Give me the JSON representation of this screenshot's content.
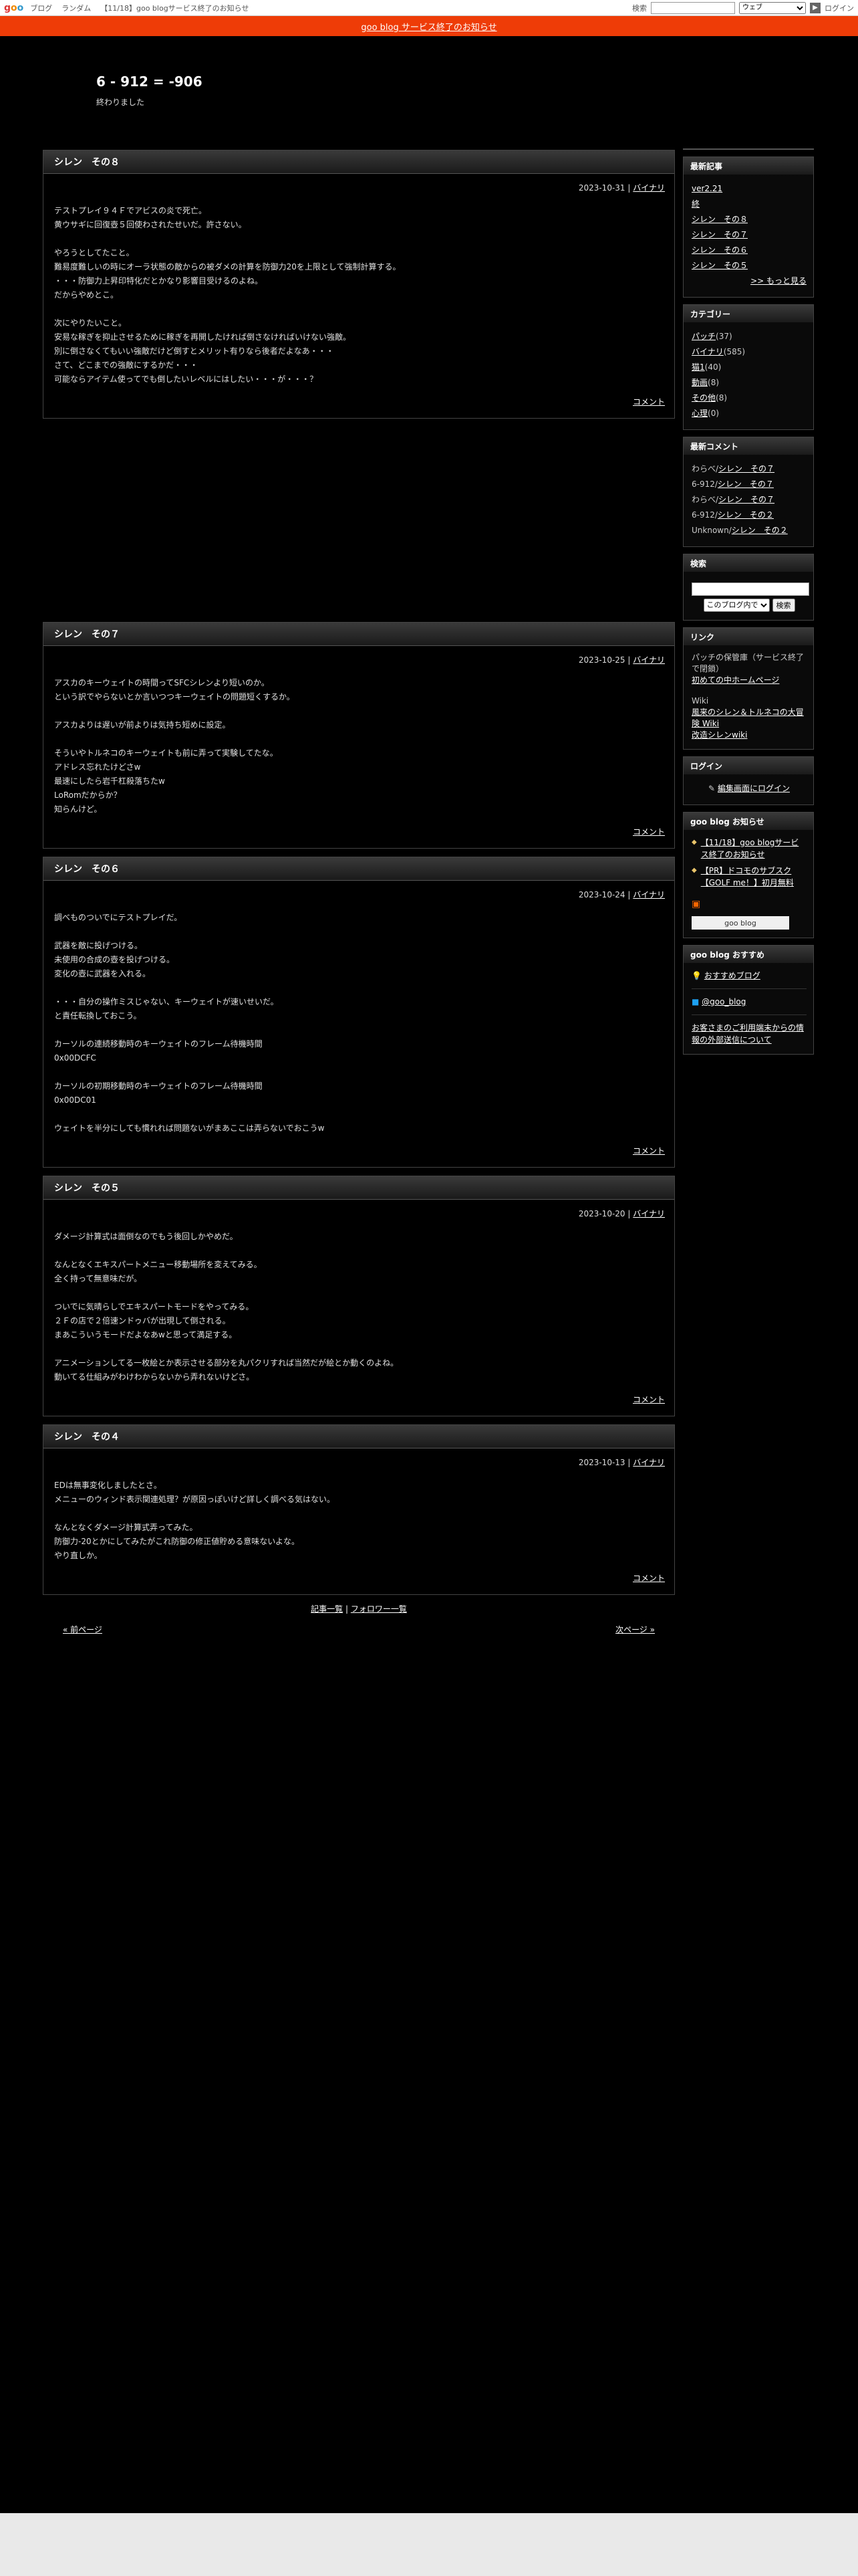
{
  "topbar": {
    "logo": "goo",
    "links": [
      "ブログ",
      "ランダム"
    ],
    "notice": "【11/18】goo blogサービス終了のお知らせ",
    "search_label": "検索",
    "search_select": "ウェブ",
    "login": "ログイン"
  },
  "notice_bar": "goo blog サービス終了のお知らせ",
  "blog": {
    "title": "6 - 912 = -906",
    "description": "終わりました"
  },
  "entries": [
    {
      "title": "シレン　その８",
      "date": "2023-10-31",
      "category": "バイナリ",
      "lines": [
        "テストプレイ９４Ｆでアビスの炎で死亡。",
        "黄ウサギに回復壺５回使わされたせいだ。許さない。",
        "",
        "やろうとしてたこと。",
        "難易度難しいの時にオーラ状態の敵からの被ダメの計算を防御力20を上限として強制計算する。",
        "・・・防御力上昇印特化だとかなり影響目受けるのよね。",
        "だからやめとこ。",
        "",
        "次にやりたいこと。",
        "安易な稼ぎを抑止させるために稼ぎを再開したければ倒さなければいけない強敵。",
        "別に倒さなくてもいい強敵だけど倒すとメリット有りなら後者だよなあ・・・",
        "さて、どこまでの強敵にするかだ・・・",
        "可能ならアイテム使ってでも倒したいレベルにはしたい・・・が・・・？"
      ],
      "footer": "コメント"
    },
    {
      "title": "シレン　その７",
      "date": "2023-10-25",
      "category": "バイナリ",
      "lines": [
        "アスカのキーウェイトの時間ってSFCシレンより短いのか。",
        "という訳でやらないとか言いつつキーウェイトの問題短くするか。",
        "",
        "アスカよりは遅いが前よりは気持ち短めに設定。",
        "",
        "そういやトルネコのキーウェイトも前に弄って実験してたな。",
        "アドレス忘れたけどさw",
        "最速にしたら岩千杠殺落ちたw",
        "LoRomだからか？",
        "知らんけど。"
      ],
      "footer": "コメント"
    },
    {
      "title": "シレン　その６",
      "date": "2023-10-24",
      "category": "バイナリ",
      "lines": [
        "調べものついでにテストプレイだ。",
        "",
        "武器を敵に投げつける。",
        "未使用の合成の壺を投げつける。",
        "変化の壺に武器を入れる。",
        "",
        "・・・自分の操作ミスじゃない、キーウェイトが速いせいだ。",
        "と責任転換しておこう。",
        "",
        "カーソルの連続移動時のキーウェイトのフレーム待機時間",
        "0x00DCFC",
        "",
        "カーソルの初期移動時のキーウェイトのフレーム待機時間",
        "0x00DC01",
        "",
        "ウェイトを半分にしても慣れれば問題ないがまあここは弄らないでおこうw"
      ],
      "footer": "コメント"
    },
    {
      "title": "シレン　その５",
      "date": "2023-10-20",
      "category": "バイナリ",
      "lines": [
        "ダメージ計算式は面倒なのでもう後回しかやめだ。",
        "",
        "なんとなくエキスパートメニュー移動場所を変えてみる。",
        "全く持って無意味だが。",
        "",
        "ついでに気晴らしでエキスパートモードをやってみる。",
        "２Ｆの店で２倍速ンドゥバが出現して倒される。",
        "まあこういうモードだよなあwと思って満足する。",
        "",
        "アニメーションしてる一枚絵とか表示させる部分を丸パクリすれば当然だが絵とか動くのよね。",
        "動いてる仕組みがわけわからないから弄れないけどさ。"
      ],
      "footer": "コメント"
    },
    {
      "title": "シレン　その４",
      "date": "2023-10-13",
      "category": "バイナリ",
      "lines": [
        "EDは無事変化しましたとさ。",
        "メニューのウィンド表示関連処理？が原因っぽいけど詳しく調べる気はない。",
        "",
        "なんとなくダメージ計算式弄ってみた。",
        "防御力-20とかにしてみたがこれ防御の修正値貯める意味ないよな。",
        "やり直しか。"
      ],
      "footer": "コメント"
    }
  ],
  "bottom": {
    "article_list": "記事一覧",
    "divider": "|",
    "follower_list": "フォロワー一覧",
    "prev": "« 前ページ",
    "next": "次ページ »"
  },
  "sidebar": {
    "recent": {
      "title": "最新記事",
      "items": [
        "ver2.21",
        "終",
        "シレン　その８",
        "シレン　その７",
        "シレン　その６",
        "シレン　その５"
      ],
      "more": ">> もっと見る"
    },
    "categories": {
      "title": "カテゴリー",
      "items": [
        {
          "name": "パッチ",
          "count": "(37)"
        },
        {
          "name": "バイナリ",
          "count": "(585)"
        },
        {
          "name": "猫1",
          "count": "(40)"
        },
        {
          "name": "動画",
          "count": "(8)"
        },
        {
          "name": "その他",
          "count": "(8)"
        },
        {
          "name": "心理",
          "count": "(0)"
        }
      ]
    },
    "comments": {
      "title": "最新コメント",
      "items": [
        {
          "user": "わらべ/",
          "post": "シレン　その７"
        },
        {
          "user": "6-912/",
          "post": "シレン　その７"
        },
        {
          "user": "わらべ/",
          "post": "シレン　その７"
        },
        {
          "user": "6-912/",
          "post": "シレン　その２"
        },
        {
          "user": "Unknown/",
          "post": "シレン　その２"
        }
      ]
    },
    "search": {
      "title": "検索",
      "select": "このブログ内で",
      "button": "検索"
    },
    "links": {
      "title": "リンク",
      "text1": "パッチの保管庫（サービス終了で閉鎖）",
      "link1": "初めての中ホームページ",
      "text2": "Wiki",
      "link2": "風来のシレン＆トルネコの大冒険 Wiki",
      "link3": "改造シレンwiki"
    },
    "login": {
      "title": "ログイン",
      "link": "編集画面にログイン"
    },
    "goo_notice": {
      "title": "goo blog お知らせ",
      "items": [
        "【11/18】goo blogサービス終了のお知らせ",
        "【PR】ドコモのサブスク【GOLF me！】初月無料"
      ],
      "badge": "goo blog"
    },
    "recommend": {
      "title": "goo blog おすすめ",
      "item": "おすすめブログ",
      "twitter": "@goo_blog",
      "external": "お客さまのご利用端末からの情報の外部送信について"
    }
  },
  "colors": {
    "notice_bar": "#ee3c07",
    "page_bg": "#000000"
  }
}
